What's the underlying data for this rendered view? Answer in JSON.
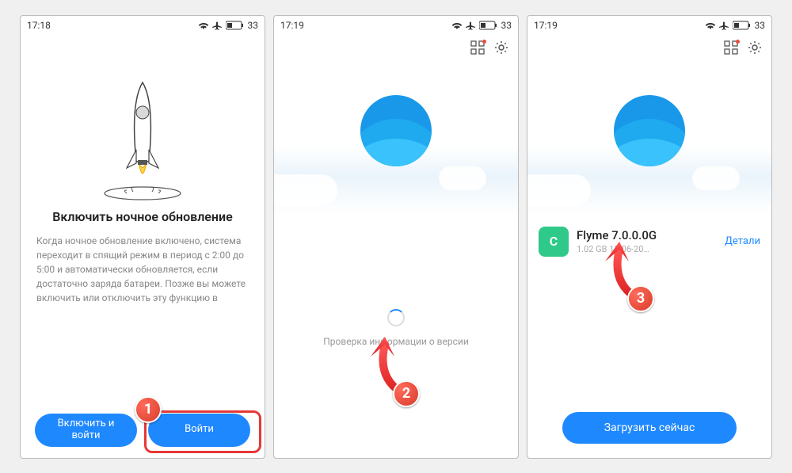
{
  "screen1": {
    "status": {
      "time": "17:18",
      "battery": "33"
    },
    "title": "Включить ночное обновление",
    "body": "Когда ночное обновление включено, система переходит в спящий режим в период с 2:00 до 5:00 и автоматически обновляется, если достаточно заряда батареи. Позже вы можете включить или отключить эту функцию в",
    "btn_enable": "Включить и войти",
    "btn_enter": "Войти",
    "badge": "1"
  },
  "screen2": {
    "status": {
      "time": "17:19",
      "battery": "33"
    },
    "checking": "Проверка информации о версии",
    "badge": "2"
  },
  "screen3": {
    "status": {
      "time": "17:19",
      "battery": "33"
    },
    "update": {
      "icon_letter": "C",
      "name": "Flyme 7.0.0.0G",
      "subtitle": "1.02 GB  15-06-20…",
      "details": "Детали"
    },
    "download": "Загрузить сейчас",
    "badge": "3"
  }
}
